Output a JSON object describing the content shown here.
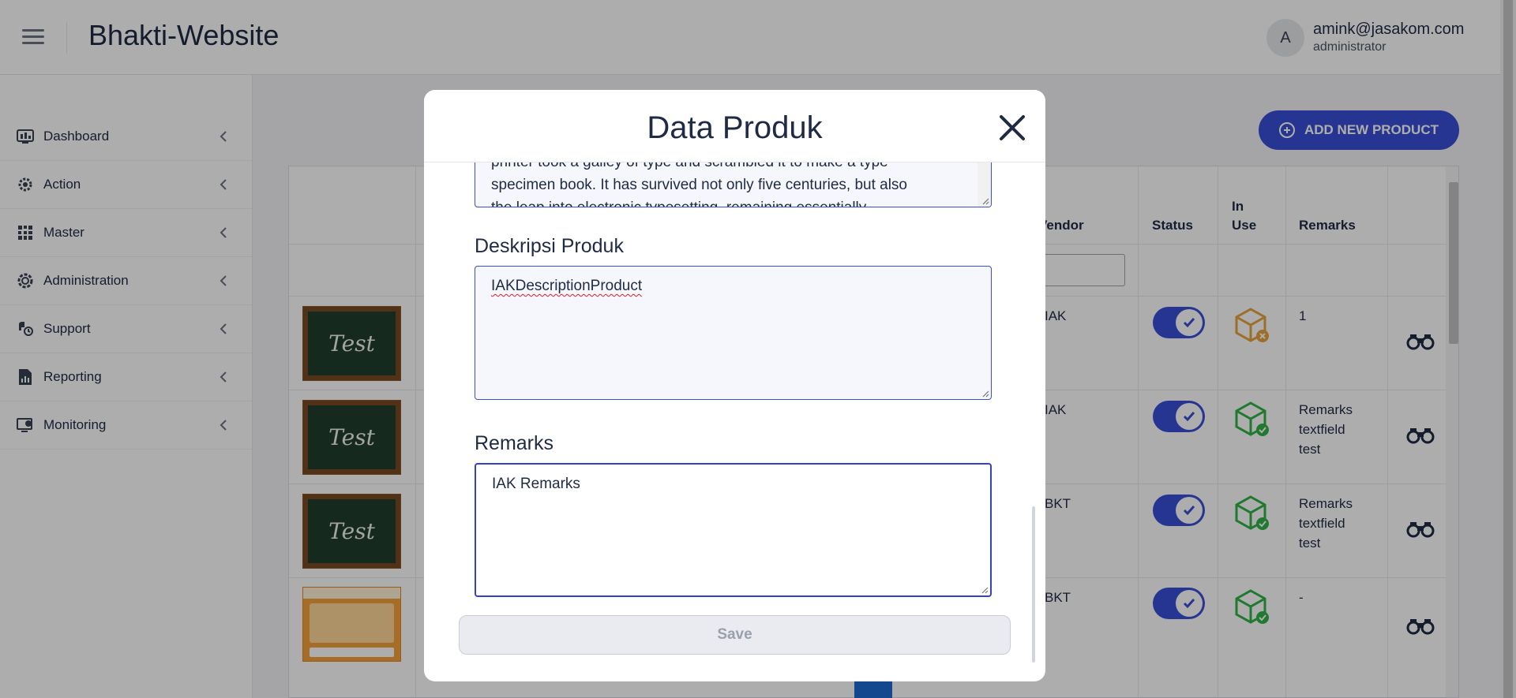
{
  "header": {
    "app_title": "Bhakti-Website",
    "avatar_initial": "A",
    "user_email": "amink@jasakom.com",
    "user_role": "administrator"
  },
  "sidebar": {
    "items": [
      {
        "label": "Dashboard",
        "icon": "dashboard-icon"
      },
      {
        "label": "Action",
        "icon": "gears-icon"
      },
      {
        "label": "Master",
        "icon": "grid-icon"
      },
      {
        "label": "Administration",
        "icon": "cog-icon"
      },
      {
        "label": "Support",
        "icon": "support-icon"
      },
      {
        "label": "Reporting",
        "icon": "report-icon"
      },
      {
        "label": "Monitoring",
        "icon": "monitor-icon"
      }
    ]
  },
  "main": {
    "add_button_label": "ADD NEW PRODUCT",
    "table": {
      "headers": {
        "vendor": "Vendor",
        "status": "Status",
        "in_use_line1": "In",
        "in_use_line2": "Use",
        "remarks": "Remarks"
      },
      "rows": [
        {
          "image": "Test",
          "vendor": "IAK",
          "status_on": true,
          "in_use": "not-in-use",
          "remarks": [
            "1"
          ]
        },
        {
          "image": "Test",
          "vendor": "IAK",
          "status_on": true,
          "in_use": "in-use",
          "remarks": [
            "Remarks",
            "textfield",
            "test"
          ]
        },
        {
          "image": "Test",
          "vendor": "BKT",
          "status_on": true,
          "in_use": "in-use",
          "remarks": [
            "Remarks",
            "textfield",
            "test"
          ]
        },
        {
          "image": "promo-banner",
          "vendor": "BKT",
          "status_on": true,
          "in_use": "in-use",
          "remarks": [
            "-"
          ]
        }
      ]
    }
  },
  "modal": {
    "title": "Data Produk",
    "previous_field_text_line1": "printer took a galley of type and scrambled it to make a type",
    "previous_field_text_line2": "specimen book. It has survived not only five centuries, but also",
    "previous_field_text_line3": "the leap into electronic typesetting, remaining essentially",
    "description_label": "Deskripsi Produk",
    "description_value": "IAKDescriptionProduct",
    "remarks_label": "Remarks",
    "remarks_value": "IAK Remarks",
    "save_label": "Save"
  },
  "colors": {
    "accent": "#3a4fd7",
    "in_use_green": "#2fb344",
    "not_in_use_orange": "#e8a33b"
  }
}
